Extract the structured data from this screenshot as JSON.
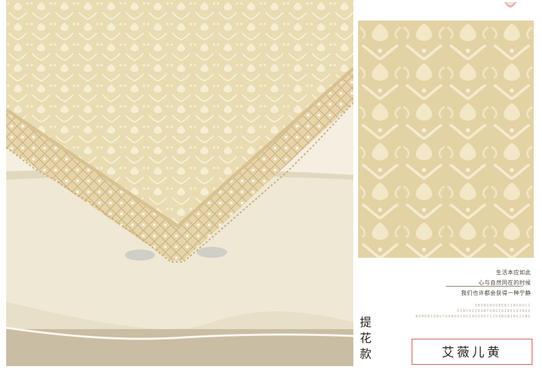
{
  "slogan": {
    "line1": "生活本应如此",
    "line2": "心与自然同在的时候",
    "line3": "我们也许都会获得一种宁静"
  },
  "pinyin": {
    "line1": "SHENGHUOBENYINGRUCI",
    "line2": "XINYUZIRANTONGZAIDESHIHOU",
    "line3": "WOMENYONGYUANDOUHUIHUODEYIZHONGNINGJING"
  },
  "style_label": [
    "提",
    "花",
    "款"
  ],
  "brand": "艾薇儿黄",
  "colors": {
    "fabric": "#e8d9ae",
    "lace": "#dcc497",
    "accent_border": "#c95c4c",
    "text": "#2b241d"
  }
}
